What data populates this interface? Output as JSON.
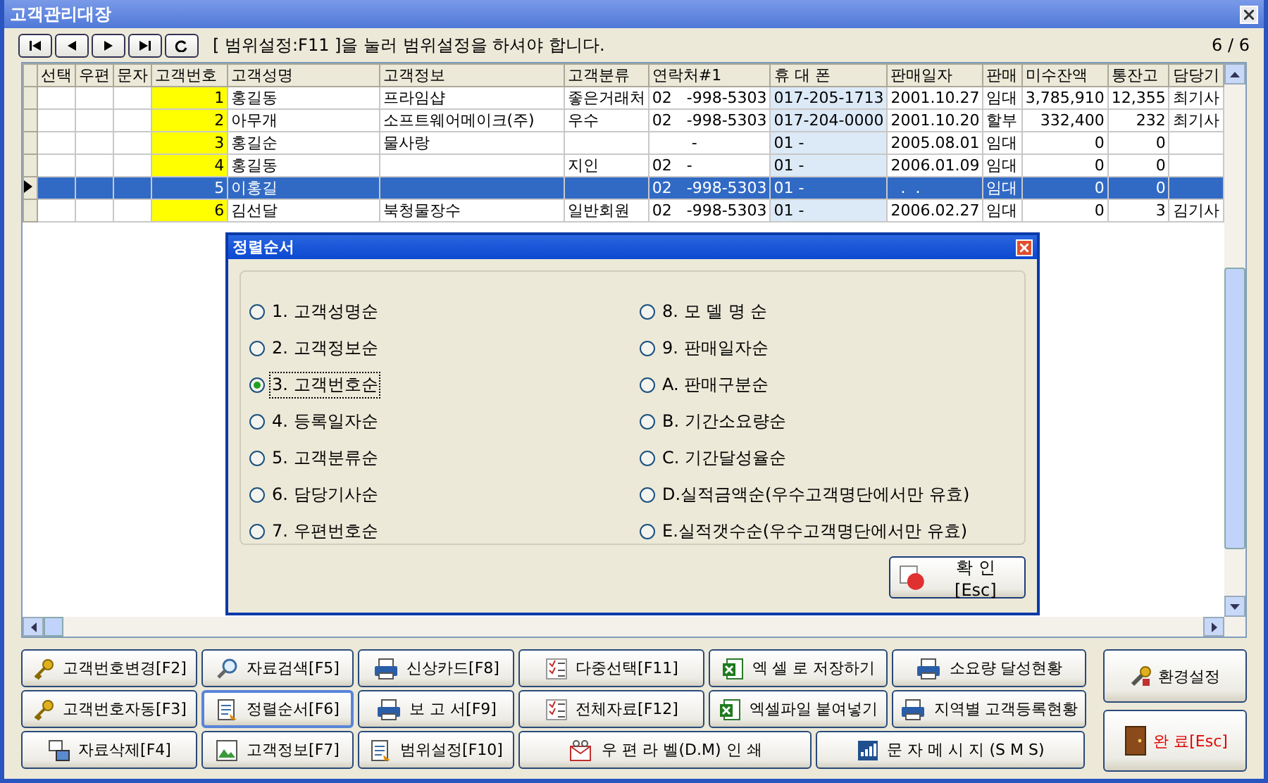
{
  "window": {
    "title": "고객관리대장"
  },
  "toolbar": {
    "message": "[ 범위설정:F11 ]을 눌러 범위설정을 하셔야 합니다.",
    "counter": "6 / 6"
  },
  "table": {
    "columns": [
      "선택",
      "우편",
      "문자",
      "고객번호",
      "고객성명",
      "고객정보",
      "고객분류",
      "연락처#1",
      "휴 대 폰",
      "판매일자",
      "판매",
      "미수잔액",
      "통잔고",
      "담당기"
    ],
    "rows": [
      {
        "selected": false,
        "customer_no": "1",
        "name": "홍길동",
        "info": "프라임샵",
        "category": "좋은거래처",
        "contact": "02   -998-5303",
        "mobile": "017-205-1713",
        "sale_date": "2001.10.27",
        "sale_type": "임대",
        "balance": "3,785,910",
        "account": "12,355",
        "manager": "최기사"
      },
      {
        "selected": false,
        "customer_no": "2",
        "name": "아무개",
        "info": "소프트웨어메이크(주)",
        "category": "우수",
        "contact": "02   -998-5303",
        "mobile": "017-204-0000",
        "sale_date": "2001.10.20",
        "sale_type": "할부",
        "balance": "332,400",
        "account": "232",
        "manager": "최기사"
      },
      {
        "selected": false,
        "customer_no": "3",
        "name": "홍길순",
        "info": "물사랑",
        "contact": "        -",
        "mobile": "01 -",
        "sale_date": "2005.08.01",
        "sale_type": "임대",
        "balance": "0",
        "account": "0"
      },
      {
        "selected": false,
        "customer_no": "4",
        "name": "홍길동",
        "category": "지인",
        "contact": "02   -",
        "mobile": "01 -",
        "sale_date": "2006.01.09",
        "sale_type": "임대",
        "balance": "0",
        "account": "0"
      },
      {
        "selected": true,
        "customer_no": "5",
        "name": "이홍길",
        "contact": "02   -998-5303",
        "mobile": "01 -",
        "sale_date": "  .  .",
        "sale_type": "임대",
        "balance": "0",
        "account": "0"
      },
      {
        "selected": false,
        "customer_no": "6",
        "name": "김선달",
        "info": "북청물장수",
        "category": "일반회원",
        "contact": "02   -998-5303",
        "mobile": "01 -",
        "sale_date": "2006.02.27",
        "sale_type": "임대",
        "balance": "0",
        "account": "3",
        "manager": "김기사"
      }
    ]
  },
  "dialog": {
    "title": "정렬순서",
    "options": [
      {
        "label": "1. 고객성명순",
        "selected": false
      },
      {
        "label": "2. 고객정보순",
        "selected": false
      },
      {
        "label": "3. 고객번호순",
        "selected": true
      },
      {
        "label": "4. 등록일자순",
        "selected": false
      },
      {
        "label": "5. 고객분류순",
        "selected": false
      },
      {
        "label": "6. 담당기사순",
        "selected": false
      },
      {
        "label": "7. 우편번호순",
        "selected": false
      },
      {
        "label": "8. 모 델 명 순",
        "selected": false
      },
      {
        "label": "9. 판매일자순",
        "selected": false
      },
      {
        "label": "A. 판매구분순",
        "selected": false
      },
      {
        "label": "B. 기간소요량순",
        "selected": false
      },
      {
        "label": "C. 기간달성율순",
        "selected": false
      },
      {
        "label": "D.실적금액순(우수고객명단에서만 유효)",
        "selected": false
      },
      {
        "label": "E.실적갯수순(우수고객명단에서만 유효)",
        "selected": false
      }
    ],
    "ok_button": "확 인[Esc]"
  },
  "buttons": [
    [
      {
        "label": "고객번호변경[F2]",
        "focused": false
      },
      {
        "label": "자료검색[F5]",
        "focused": false
      },
      {
        "label": "신상카드[F8]",
        "focused": false
      },
      {
        "label": "다중선택[F11]",
        "focused": false
      },
      {
        "label": "엑 셀 로 저장하기",
        "focused": false
      },
      {
        "label": "소요량 달성현황",
        "focused": false
      }
    ],
    [
      {
        "label": "고객번호자동[F3]",
        "focused": false
      },
      {
        "label": "정렬순서[F6]",
        "focused": true
      },
      {
        "label": "보 고 서[F9]",
        "focused": false
      },
      {
        "label": "전체자료[F12]",
        "focused": false
      },
      {
        "label": "엑셀파일 붙여넣기",
        "focused": false
      },
      {
        "label": "지역별 고객등록현황",
        "focused": false
      }
    ],
    [
      {
        "label": "자료삭제[F4]",
        "focused": false
      },
      {
        "label": "고객정보[F7]",
        "focused": false
      },
      {
        "label": "범위설정[F10]",
        "focused": false
      },
      {
        "label": "우 편 라 벨(D.M) 인 쇄",
        "focused": false
      },
      {
        "label": "문 자 메 시 지 (S M S)",
        "focused": false
      }
    ]
  ],
  "side_buttons": [
    {
      "label": "환경설정",
      "kind": "normal"
    },
    {
      "label": "완 료[Esc]",
      "kind": "exit"
    }
  ]
}
